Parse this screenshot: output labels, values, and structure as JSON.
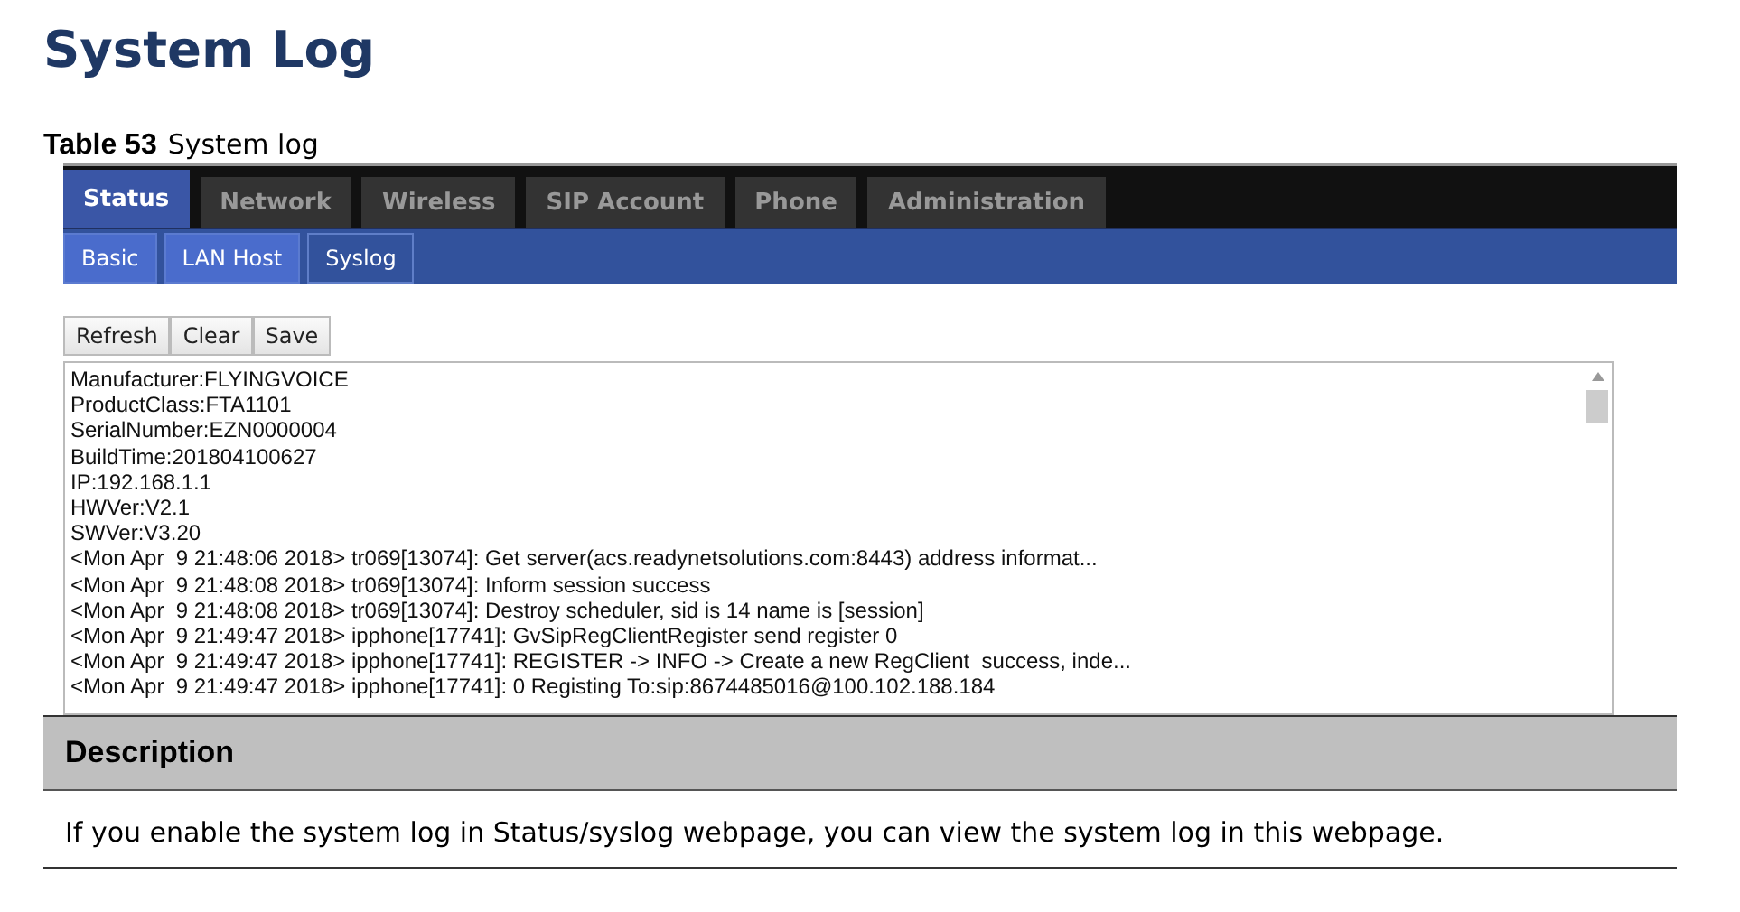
{
  "heading": "System Log",
  "caption": {
    "label": "Table 53",
    "text": "System log"
  },
  "main_tabs": [
    {
      "label": "Status",
      "selected": true
    },
    {
      "label": "Network",
      "selected": false
    },
    {
      "label": "Wireless",
      "selected": false
    },
    {
      "label": "SIP Account",
      "selected": false
    },
    {
      "label": "Phone",
      "selected": false
    },
    {
      "label": "Administration",
      "selected": false
    }
  ],
  "sub_tabs": [
    {
      "label": "Basic",
      "selected": false
    },
    {
      "label": "LAN Host",
      "selected": false
    },
    {
      "label": "Syslog",
      "selected": true
    }
  ],
  "buttons": [
    "Refresh",
    "Clear",
    "Save"
  ],
  "log_lines": [
    "Manufacturer:FLYINGVOICE",
    "ProductClass:FTA1101",
    "SerialNumber:EZN0000004",
    "BuildTime:201804100627",
    "IP:192.168.1.1",
    "HWVer:V2.1",
    "SWVer:V3.20",
    "<Mon Apr  9 21:48:06 2018> tr069[13074]: Get server(acs.readynetsolutions.com:8443) address informat...",
    "<Mon Apr  9 21:48:08 2018> tr069[13074]: Inform session success",
    "<Mon Apr  9 21:48:08 2018> tr069[13074]: Destroy scheduler, sid is 14 name is [session]",
    "<Mon Apr  9 21:49:47 2018> ipphone[17741]: GvSipRegClientRegister send register 0",
    "<Mon Apr  9 21:49:47 2018> ipphone[17741]: REGISTER -> INFO -> Create a new RegClient  success, inde...",
    "<Mon Apr  9 21:49:47 2018> ipphone[17741]: 0 Registing To:sip:8674485016@100.102.188.184"
  ],
  "description": {
    "header": "Description",
    "text": "If you enable the system log in Status/syslog webpage, you can view the system log in this webpage."
  }
}
